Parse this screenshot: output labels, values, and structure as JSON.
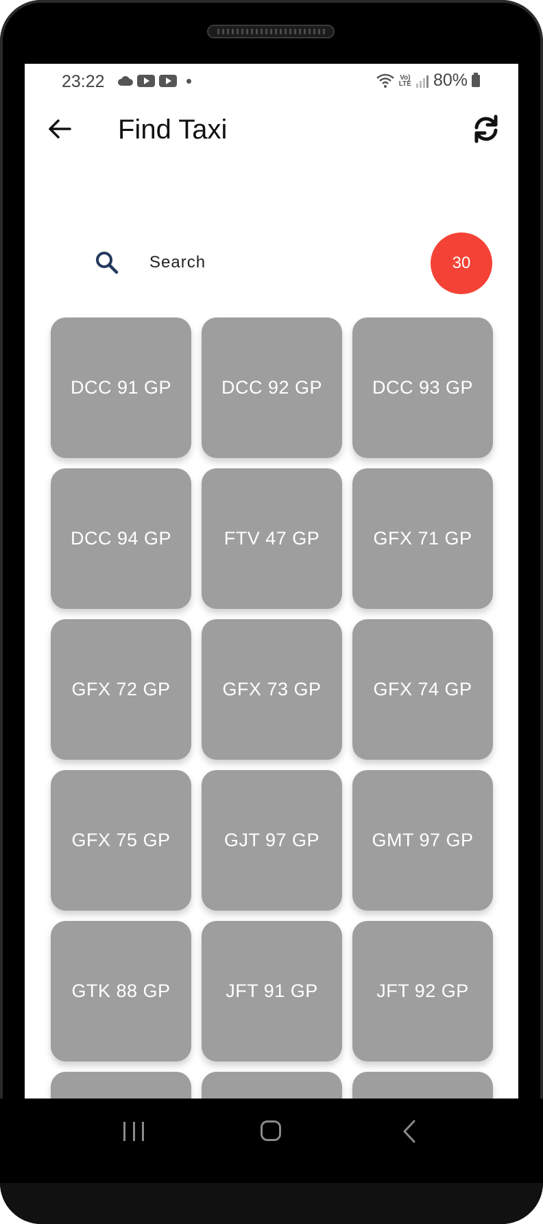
{
  "status_bar": {
    "time": "23:22",
    "battery": "80%"
  },
  "app_bar": {
    "title": "Find Taxi"
  },
  "search": {
    "placeholder": "Search",
    "value": ""
  },
  "count_badge": "30",
  "colors": {
    "tile_bg": "#9e9e9e",
    "badge_bg": "#f44336",
    "search_icon": "#23395d"
  },
  "taxis": [
    "DCC 91 GP",
    "DCC 92 GP",
    "DCC 93 GP",
    "DCC 94 GP",
    "FTV 47 GP",
    "GFX 71 GP",
    "GFX 72 GP",
    "GFX 73 GP",
    "GFX 74 GP",
    "GFX 75 GP",
    "GJT 97 GP",
    "GMT 97 GP",
    "GTK 88 GP",
    "JFT 91 GP",
    "JFT 92 GP",
    "",
    "",
    ""
  ]
}
